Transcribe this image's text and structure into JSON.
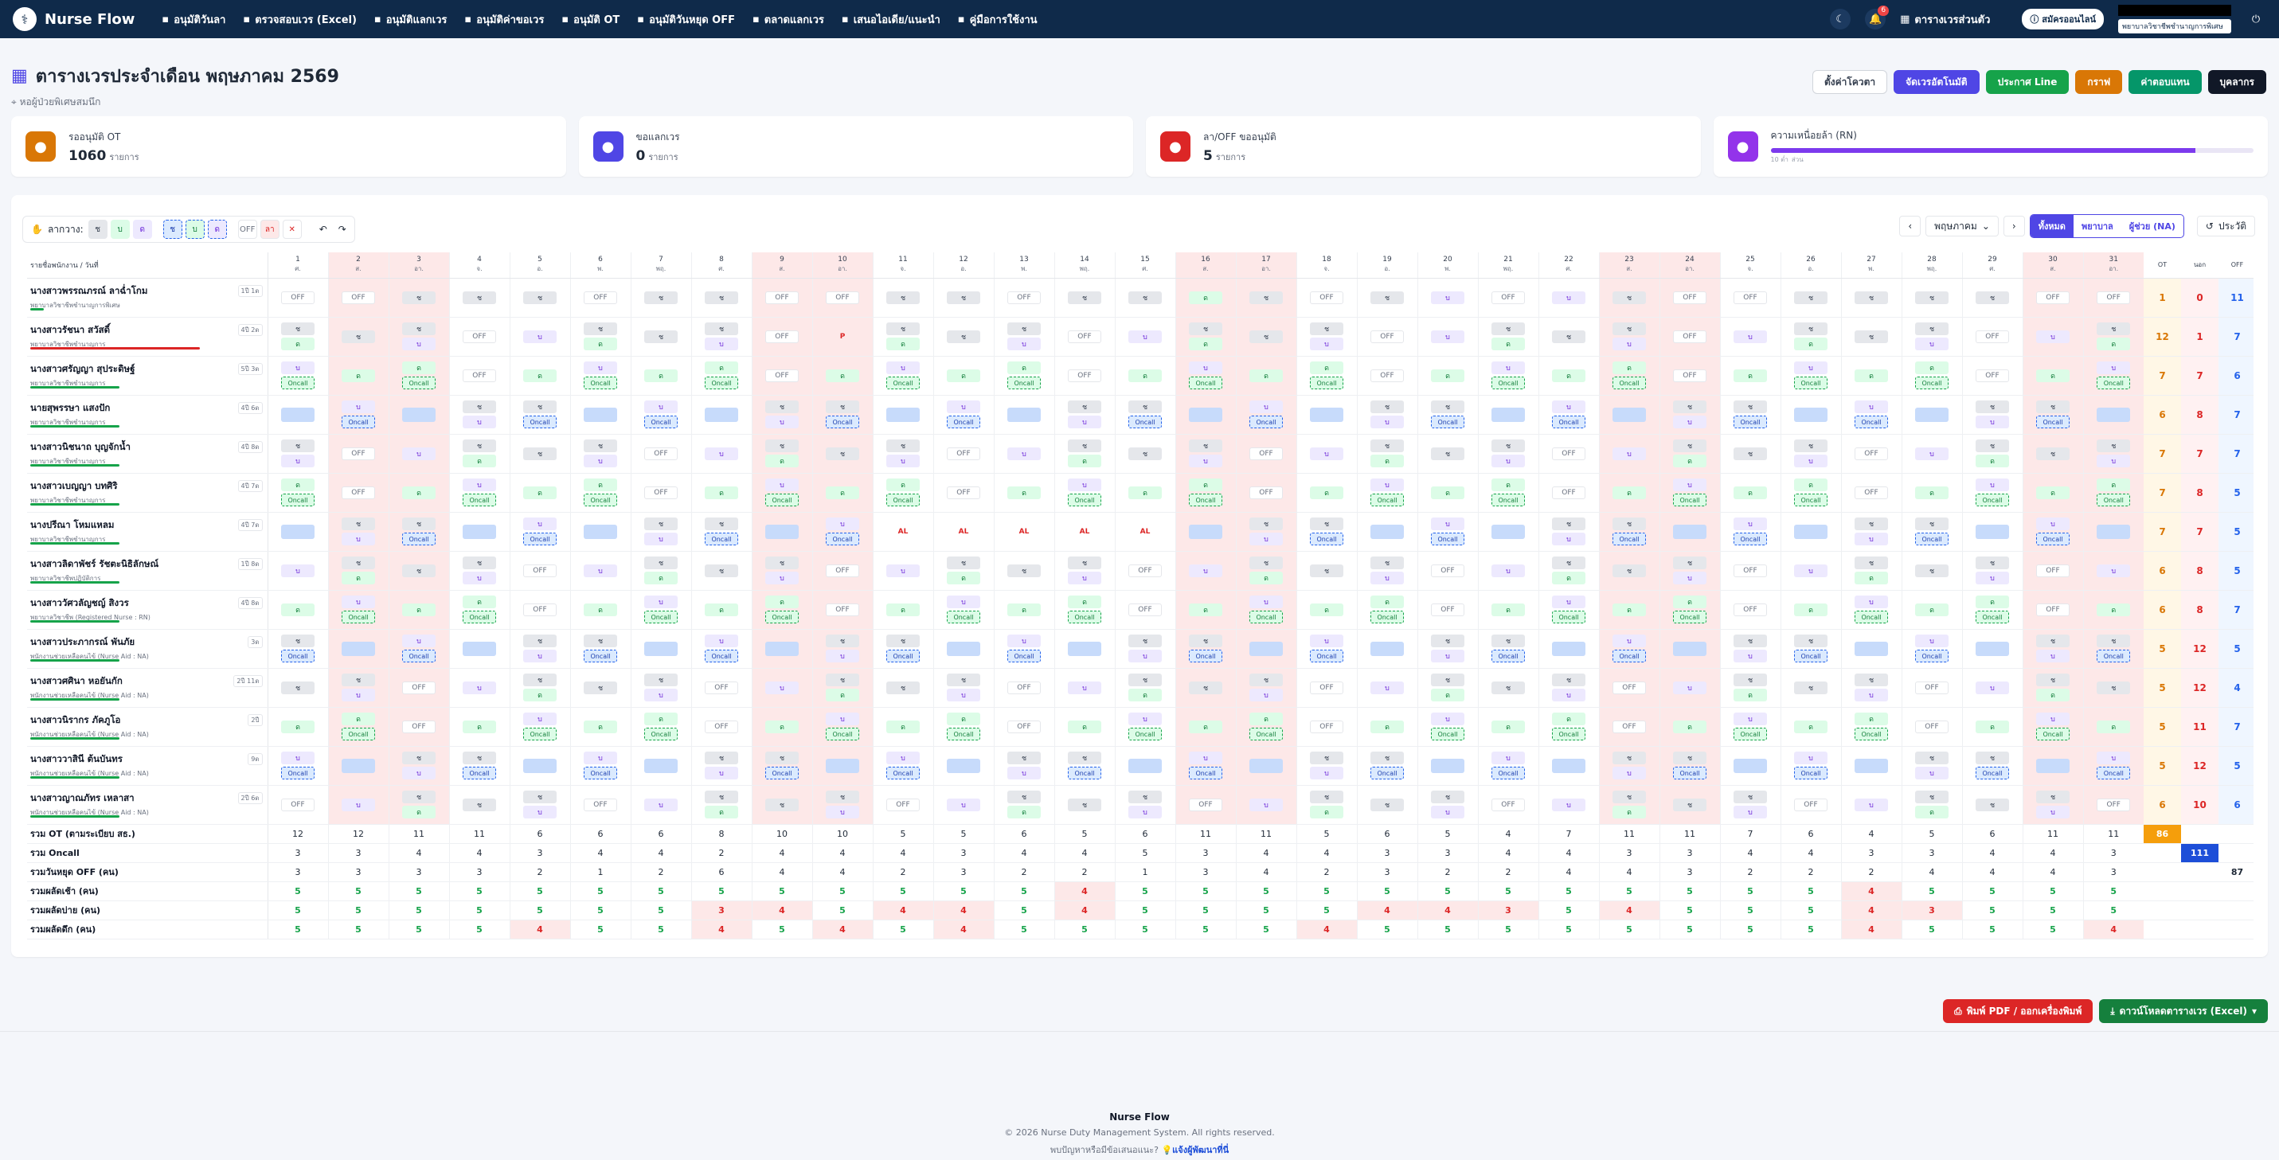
{
  "nav": {
    "brand": "Nurse Flow",
    "items": [
      {
        "icon": "calendar-check-icon",
        "label": "อนุมัติวันลา"
      },
      {
        "icon": "file-excel-icon",
        "label": "ตรวจสอบเวร (Excel)"
      },
      {
        "icon": "swap-icon",
        "label": "อนุมัติแลกเวร"
      },
      {
        "icon": "edit-icon",
        "label": "อนุมัติค่าขอเวร"
      },
      {
        "icon": "clock-icon",
        "label": "อนุมัติ OT"
      },
      {
        "icon": "calendar-off-icon",
        "label": "อนุมัติวันหยุด OFF"
      },
      {
        "icon": "market-icon",
        "label": "ตลาดแลกเวร"
      },
      {
        "icon": "idea-icon",
        "label": "เสนอไอเดีย/แนะนำ"
      },
      {
        "icon": "book-icon",
        "label": "คู่มือการใช้งาน"
      }
    ],
    "notif_count": "6",
    "my_schedule": "ตารางเวรส่วนตัว",
    "status_pill": "สมัครออนไลน์",
    "role": "พยาบาลวิชาชีพชำนาญการพิเศษ"
  },
  "header": {
    "title": "ตารางเวรประจำเดือน พฤษภาคม 2569",
    "ward": "หอผู้ป่วยพิเศษสมนึก"
  },
  "actions": [
    {
      "label": "ตั้งค่าโควตา",
      "bg": "#ffffff",
      "fg": "#374151",
      "border": "#d1d5db"
    },
    {
      "label": "จัดเวรอัตโนมัติ",
      "bg": "#4f46e5",
      "fg": "#ffffff",
      "border": "#4f46e5"
    },
    {
      "label": "ประกาศ Line",
      "bg": "#16a34a",
      "fg": "#ffffff",
      "border": "#16a34a"
    },
    {
      "label": "กราฟ",
      "bg": "#d97706",
      "fg": "#ffffff",
      "border": "#d97706"
    },
    {
      "label": "ค่าตอบแทน",
      "bg": "#059669",
      "fg": "#ffffff",
      "border": "#059669"
    },
    {
      "label": "บุคลากร",
      "bg": "#111827",
      "fg": "#ffffff",
      "border": "#111827"
    }
  ],
  "cards": [
    {
      "label": "รออนุมัติ OT",
      "value": "1060",
      "unit": "รายการ",
      "color": "#d97706",
      "icon": "clock-icon"
    },
    {
      "label": "ขอแลกเวร",
      "value": "0",
      "unit": "รายการ",
      "color": "#4f46e5",
      "icon": "swap-icon"
    },
    {
      "label": "ลา/OFF ขออนุมัติ",
      "value": "5",
      "unit": "รายการ",
      "color": "#dc2626",
      "icon": "calendar-icon"
    },
    {
      "label": "ความเหนื่อยล้า (RN)",
      "value": "",
      "unit": "",
      "color": "#9333ea",
      "icon": "heart-icon",
      "avg": "AVG: 25.4",
      "progress": 0.88,
      "scale_lo": "10 ต่ำ",
      "scale_hi": "ส่วน"
    }
  ],
  "tools": {
    "label": "ลากวาง:",
    "chips": [
      "ช",
      "บ",
      "ด",
      "ช",
      "บ",
      "ด",
      "OFF",
      "ลา",
      "✕"
    ]
  },
  "filters": {
    "month": "พฤษภาคม",
    "segments": [
      "ทั้งหมด",
      "พยาบาล",
      "ผู้ช่วย (NA)"
    ],
    "history": "ประวัติ"
  },
  "grid": {
    "name_header": "รายชื่อพนักงาน / วันที่",
    "tot_headers": [
      "OT",
      "นอก",
      "OFF"
    ],
    "days": [
      {
        "d": "1",
        "w": "ศ."
      },
      {
        "d": "2",
        "w": "ส."
      },
      {
        "d": "3",
        "w": "อา."
      },
      {
        "d": "4",
        "w": "จ."
      },
      {
        "d": "5",
        "w": "อ."
      },
      {
        "d": "6",
        "w": "พ."
      },
      {
        "d": "7",
        "w": "พฤ."
      },
      {
        "d": "8",
        "w": "ศ."
      },
      {
        "d": "9",
        "w": "ส."
      },
      {
        "d": "10",
        "w": "อา."
      },
      {
        "d": "11",
        "w": "จ."
      },
      {
        "d": "12",
        "w": "อ."
      },
      {
        "d": "13",
        "w": "พ."
      },
      {
        "d": "14",
        "w": "พฤ."
      },
      {
        "d": "15",
        "w": "ศ."
      },
      {
        "d": "16",
        "w": "ส."
      },
      {
        "d": "17",
        "w": "อา."
      },
      {
        "d": "18",
        "w": "จ."
      },
      {
        "d": "19",
        "w": "อ."
      },
      {
        "d": "20",
        "w": "พ."
      },
      {
        "d": "21",
        "w": "พฤ."
      },
      {
        "d": "22",
        "w": "ศ."
      },
      {
        "d": "23",
        "w": "ส."
      },
      {
        "d": "24",
        "w": "อา."
      },
      {
        "d": "25",
        "w": "จ."
      },
      {
        "d": "26",
        "w": "อ."
      },
      {
        "d": "27",
        "w": "พ."
      },
      {
        "d": "28",
        "w": "พฤ."
      },
      {
        "d": "29",
        "w": "ศ."
      },
      {
        "d": "30",
        "w": "ส."
      },
      {
        "d": "31",
        "w": "อา."
      }
    ],
    "weekend": [
      1,
      2,
      8,
      9,
      15,
      16,
      22,
      23,
      29,
      30
    ],
    "staff": [
      {
        "name": "นางสาวพรรณภรณ์ ลาฉ่ำโกม",
        "role": "พยาบาลวิชาชีพชำนาญการพิเศษ",
        "tag": "1ปี 1ด",
        "bar": 0.06,
        "ot": "1",
        "out": "0",
        "off": "11"
      },
      {
        "name": "นางสาวรัชนา สวัสดิ์",
        "role": "พยาบาลวิชาชีพชำนาญการ",
        "tag": "4ปี 2ด",
        "bar": 0.76,
        "ot": "12",
        "out": "1",
        "off": "7"
      },
      {
        "name": "นางสาวศรัญญา สุประดิษฐ์",
        "role": "พยาบาลวิชาชีพชำนาญการ",
        "tag": "5ปี 3ด",
        "bar": 0.4,
        "ot": "7",
        "out": "7",
        "off": "6"
      },
      {
        "name": "นายสุพรรษา แสงปัก",
        "role": "พยาบาลวิชาชีพชำนาญการ",
        "tag": "4ปี 6ด",
        "bar": 0.4,
        "ot": "6",
        "out": "8",
        "off": "7"
      },
      {
        "name": "นางสาวนิชนาถ บุญจักน้ำ",
        "role": "พยาบาลวิชาชีพชำนาญการ",
        "tag": "4ปี 8ด",
        "bar": 0.4,
        "ot": "7",
        "out": "7",
        "off": "7"
      },
      {
        "name": "นางสาวเบญญา บทศิริ",
        "role": "พยาบาลวิชาชีพชำนาญการ",
        "tag": "4ปี 7ด",
        "bar": 0.4,
        "ot": "7",
        "out": "8",
        "off": "5"
      },
      {
        "name": "นางปรีณา โหมแหลม",
        "role": "พยาบาลวิชาชีพชำนาญการ",
        "tag": "4ปี 7ด",
        "bar": 0.4,
        "ot": "7",
        "out": "7",
        "off": "5"
      },
      {
        "name": "นางสาวลิดาพัชร์ รัชตะนิธิลักษณ์",
        "role": "พยาบาลวิชาชีพปฏิบัติการ",
        "tag": "1ปี 8ด",
        "bar": 0.4,
        "ot": "6",
        "out": "8",
        "off": "5"
      },
      {
        "name": "นางสาววัศวลัญชญ์ สิงวร",
        "role": "พยาบาลวิชาชีพ (Registered Nurse : RN)",
        "tag": "4ปี 8ด",
        "bar": 0.4,
        "ot": "6",
        "out": "8",
        "off": "7"
      },
      {
        "name": "นางสาวประภากรณ์ พันภัย",
        "role": "พนักงานช่วยเหลือคนไข้ (Nurse Aid : NA)",
        "tag": "3ด",
        "bar": 0.4,
        "ot": "5",
        "out": "12",
        "off": "5"
      },
      {
        "name": "นางสาวศศินา หอยันกัก",
        "role": "พนักงานช่วยเหลือคนไข้ (Nurse Aid : NA)",
        "tag": "2ปี 11ด",
        "bar": 0.4,
        "ot": "5",
        "out": "12",
        "off": "4"
      },
      {
        "name": "นางสาวนิรากร ภัคภูโอ",
        "role": "พนักงานช่วยเหลือคนไข้ (Nurse Aid : NA)",
        "tag": "2ปี",
        "bar": 0.4,
        "ot": "5",
        "out": "11",
        "off": "7"
      },
      {
        "name": "นางสาววาสินี ต้นบันทร",
        "role": "พนักงานช่วยเหลือคนไข้ (Nurse Aid : NA)",
        "tag": "9ด",
        "bar": 0.4,
        "ot": "5",
        "out": "12",
        "off": "5"
      },
      {
        "name": "นางสาวญาณภัทร เหลาสา",
        "role": "พนักงานช่วยเหลือคนไข้ (Nurse Aid : NA)",
        "tag": "2ปี 6ด",
        "bar": 0.4,
        "ot": "6",
        "out": "10",
        "off": "6"
      }
    ],
    "summary": [
      {
        "label": "รวม OT (ตามระเบียบ สธ.)",
        "values": [
          "12",
          "12",
          "11",
          "11",
          "6",
          "6",
          "6",
          "8",
          "10",
          "10",
          "5",
          "5",
          "6",
          "5",
          "6",
          "11",
          "11",
          "5",
          "6",
          "5",
          "4",
          "7",
          "11",
          "11",
          "7",
          "6",
          "4",
          "5",
          "6",
          "11",
          "11"
        ],
        "kind": "plain",
        "tot": [
          "86",
          "",
          ""
        ]
      },
      {
        "label": "รวม Oncall",
        "values": [
          "3",
          "3",
          "4",
          "4",
          "3",
          "4",
          "4",
          "2",
          "4",
          "4",
          "4",
          "3",
          "4",
          "4",
          "5",
          "3",
          "4",
          "4",
          "3",
          "3",
          "4",
          "4",
          "3",
          "3",
          "4",
          "4",
          "3",
          "3",
          "4",
          "4",
          "3"
        ],
        "kind": "plain",
        "tot": [
          "",
          "111",
          ""
        ]
      },
      {
        "label": "รวมวันหยุด OFF (คน)",
        "values": [
          "3",
          "3",
          "3",
          "3",
          "2",
          "1",
          "2",
          "6",
          "4",
          "4",
          "2",
          "3",
          "2",
          "2",
          "1",
          "3",
          "4",
          "2",
          "3",
          "2",
          "2",
          "4",
          "4",
          "3",
          "2",
          "2",
          "2",
          "4",
          "4",
          "4",
          "3"
        ],
        "kind": "plain",
        "tot": [
          "",
          "",
          "87"
        ]
      },
      {
        "label": "รวมผลัดเช้า (คน)",
        "values": [
          "5",
          "5",
          "5",
          "5",
          "5",
          "5",
          "5",
          "5",
          "5",
          "5",
          "5",
          "5",
          "5",
          "4",
          "5",
          "5",
          "5",
          "5",
          "5",
          "5",
          "5",
          "5",
          "5",
          "5",
          "5",
          "5",
          "4",
          "5",
          "5",
          "5",
          "5"
        ],
        "kind": "shift",
        "tot": [
          "",
          "",
          ""
        ]
      },
      {
        "label": "รวมผลัดบ่าย (คน)",
        "values": [
          "5",
          "5",
          "5",
          "5",
          "5",
          "5",
          "5",
          "3",
          "4",
          "5",
          "4",
          "4",
          "5",
          "4",
          "5",
          "5",
          "5",
          "5",
          "4",
          "4",
          "3",
          "5",
          "4",
          "5",
          "5",
          "5",
          "4",
          "3",
          "5",
          "5",
          "5"
        ],
        "kind": "shift",
        "tot": [
          "",
          "",
          ""
        ]
      },
      {
        "label": "รวมผลัดดึก (คน)",
        "values": [
          "5",
          "5",
          "5",
          "5",
          "4",
          "5",
          "5",
          "4",
          "5",
          "4",
          "5",
          "4",
          "5",
          "5",
          "5",
          "5",
          "5",
          "4",
          "5",
          "5",
          "5",
          "5",
          "5",
          "5",
          "5",
          "5",
          "4",
          "5",
          "5",
          "5",
          "4"
        ],
        "kind": "shift",
        "tot": [
          "",
          "",
          ""
        ]
      }
    ]
  },
  "bottom": {
    "print": "พิมพ์ PDF / ออกเครื่องพิมพ์",
    "excel": "ดาวน์โหลดตารางเวร (Excel)"
  },
  "footer": {
    "brand": "Nurse Flow",
    "copy": "© 2026 Nurse Duty Management System. All rights reserved.",
    "q": "พบปัญหาหรือมีข้อเสนอแนะ?",
    "link": "แจ้งผู้พัฒนาที่นี่"
  }
}
